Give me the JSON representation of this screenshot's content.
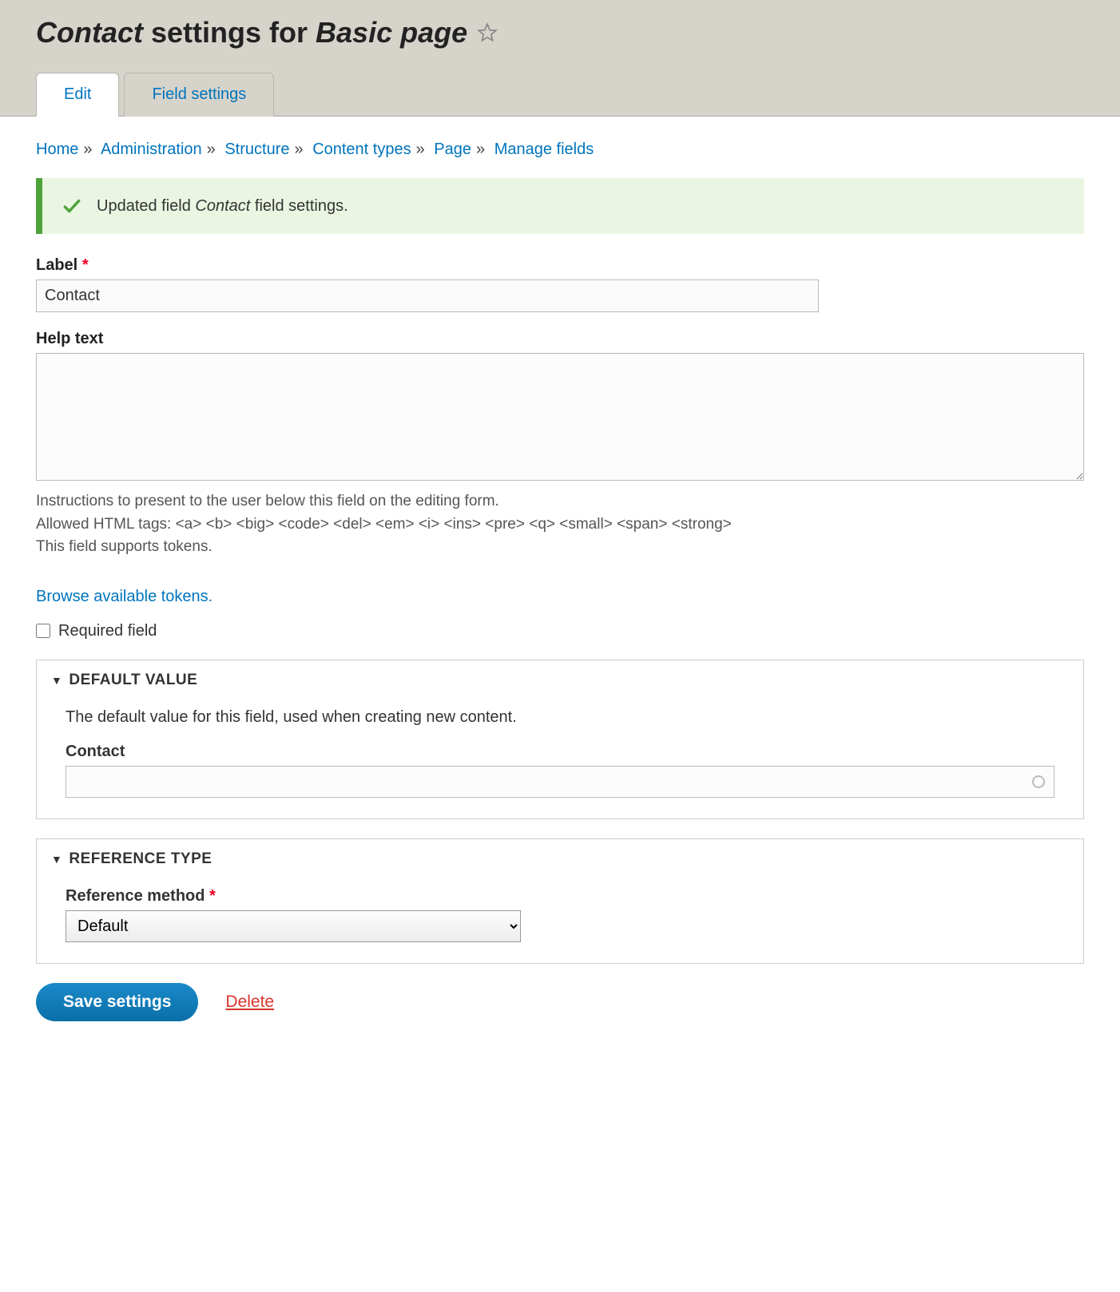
{
  "page_title": {
    "field_name": "Contact",
    "middle": " settings for ",
    "bundle": "Basic page"
  },
  "tabs": [
    {
      "label": "Edit",
      "active": true
    },
    {
      "label": "Field settings",
      "active": false
    }
  ],
  "breadcrumb": [
    "Home",
    "Administration",
    "Structure",
    "Content types",
    "Page",
    "Manage fields"
  ],
  "status": {
    "prefix": "Updated field ",
    "field_name": "Contact",
    "suffix": " field settings."
  },
  "form": {
    "label_title": "Label",
    "label_value": "Contact",
    "help_title": "Help text",
    "help_value": "",
    "help_desc_line1": "Instructions to present to the user below this field on the editing form.",
    "help_desc_line2": "Allowed HTML tags: <a> <b> <big> <code> <del> <em> <i> <ins> <pre> <q> <small> <span> <strong>",
    "help_desc_line3": "This field supports tokens.",
    "tokens_link": "Browse available tokens.",
    "required_label": "Required field",
    "default_value": {
      "summary": "Default value",
      "desc": "The default value for this field, used when creating new content.",
      "field_label": "Contact",
      "value": ""
    },
    "reference_type": {
      "summary": "Reference type",
      "method_label": "Reference method",
      "method_value": "Default"
    }
  },
  "actions": {
    "save": "Save settings",
    "delete": "Delete"
  }
}
